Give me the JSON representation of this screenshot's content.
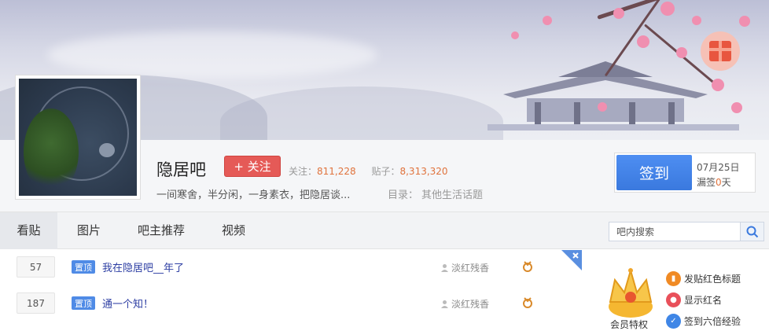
{
  "bar": {
    "name": "隐居吧",
    "follow_label": "+ 关注",
    "follow_count_label": "关注：",
    "follow_count": "811,228",
    "post_count_label": "贴子：",
    "post_count": "8,313,320",
    "slogan": "一间寒舍，半分闲，一身素衣，把隐居谈...",
    "catalog_label": "目录：",
    "catalog_value": "其他生活话题"
  },
  "sign": {
    "button_label": "签到",
    "date": "07月25日",
    "miss_prefix": "漏签",
    "miss_count": "0",
    "miss_suffix": "天"
  },
  "tabs": [
    {
      "label": "看贴",
      "active": true
    },
    {
      "label": "图片",
      "active": false
    },
    {
      "label": "吧主推荐",
      "active": false
    },
    {
      "label": "视频",
      "active": false
    }
  ],
  "search": {
    "placeholder": "吧内搜索"
  },
  "threads": [
    {
      "replies": "57",
      "badge": "置顶",
      "title": "我在隐居吧__年了",
      "author": "淡红残香"
    },
    {
      "replies": "187",
      "badge": "置顶",
      "title": "通一个知！",
      "author": "淡红残香"
    }
  ],
  "side": {
    "perks": [
      {
        "label": "发贴红色标题",
        "icon": "bookmark-icon",
        "color": "#f08a24"
      },
      {
        "label": "显示红名",
        "icon": "chat-icon",
        "color": "#e9505a"
      },
      {
        "label": "签到六倍经验",
        "icon": "sign-icon",
        "color": "#3f86e6"
      }
    ],
    "crown_label": "会员特权"
  },
  "colors": {
    "accent": "#3a79de",
    "follow": "#e55a57",
    "link": "#2d3ea3",
    "badge": "#4f8be6"
  }
}
